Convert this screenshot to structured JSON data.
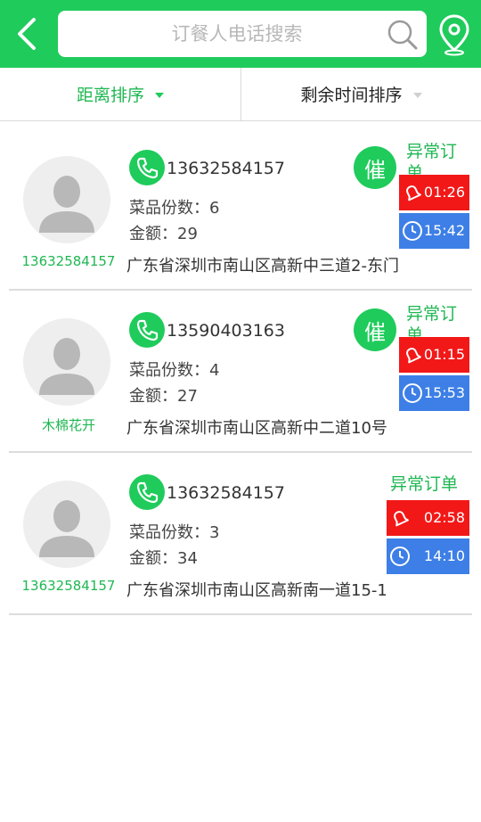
{
  "colors": {
    "brand_green": "#1fcb5b",
    "alert_red": "#f21818",
    "clock_blue": "#3d7fe6"
  },
  "header": {
    "back_icon": "chevron-left-icon",
    "search_placeholder": "订餐人电话搜索",
    "search_icon": "search-icon",
    "map_icon": "map-pin-icon"
  },
  "sort": {
    "distance_label": "距离排序",
    "time_label": "剩余时间排序"
  },
  "orders": [
    {
      "name": "13632584157",
      "phone": "13632584157",
      "dishes": "菜品份数：6",
      "amount": "金额：29",
      "address": "广东省深圳市南山区高新中三道2-东门",
      "urge": "催",
      "abnormal": "异常订单",
      "alarm_time": "01:26",
      "clock_time": "15:42"
    },
    {
      "name": "木棉花开",
      "phone": "13590403163",
      "dishes": "菜品份数：4",
      "amount": "金额：27",
      "address": "广东省深圳市南山区高新中二道10号",
      "urge": "催",
      "abnormal": "异常订单",
      "alarm_time": "01:15",
      "clock_time": "15:53"
    },
    {
      "name": "13632584157",
      "phone": "13632584157",
      "dishes": "菜品份数：3",
      "amount": "金额：34",
      "address": "广东省深圳市南山区高新南一道15-1",
      "abnormal": "异常订单",
      "alarm_time": "02:58",
      "clock_time": "14:10"
    }
  ]
}
